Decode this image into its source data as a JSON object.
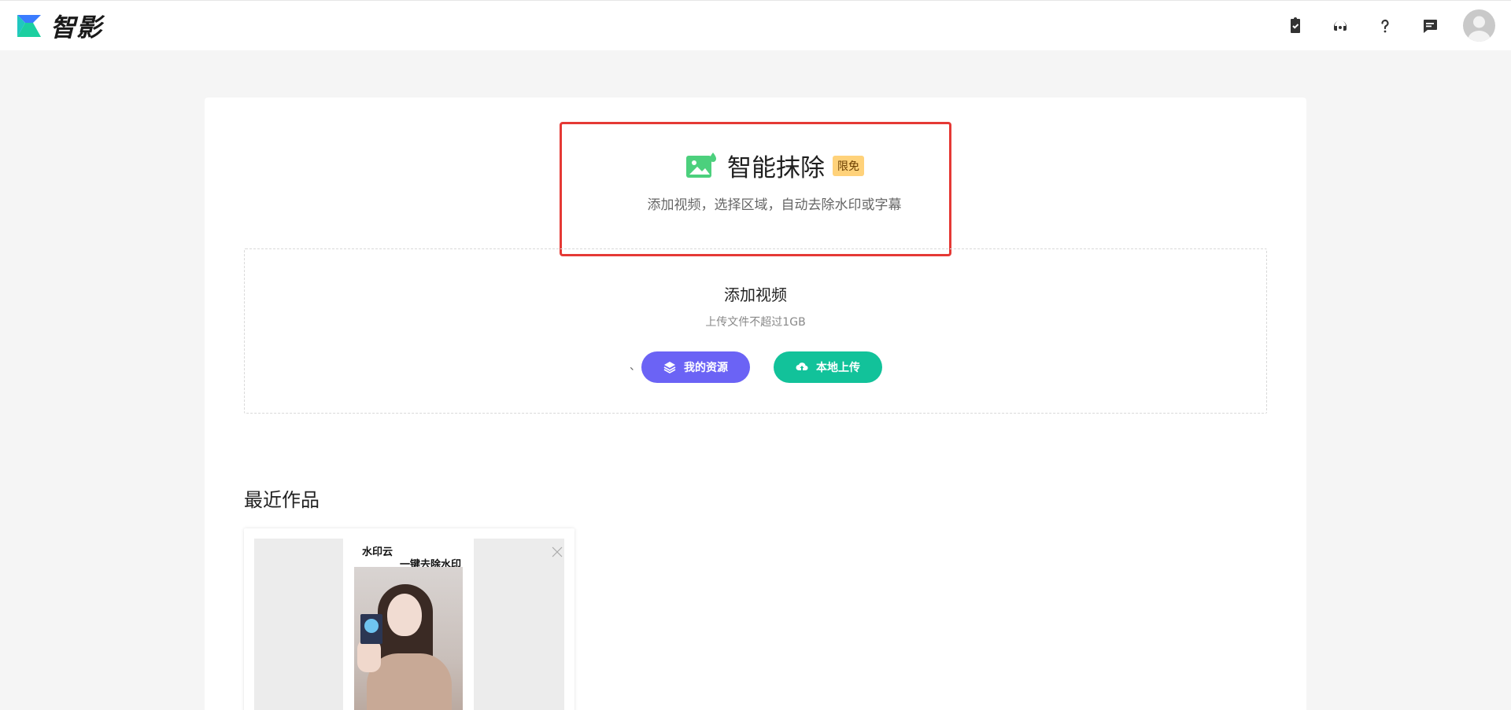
{
  "header": {
    "brand": "智影",
    "icons": [
      "clipboard-check-icon",
      "headset-icon",
      "help-icon",
      "message-icon"
    ],
    "brand_color": "#1ccfa0"
  },
  "feature": {
    "title": "智能抹除",
    "badge": "限免",
    "subtitle": "添加视频，选择区域，自动去除水印或字幕",
    "icon": "image-erase-icon"
  },
  "upload": {
    "title": "添加视频",
    "subtitle": "上传文件不超过1GB",
    "separator": "、",
    "my_resources_label": "我的资源",
    "local_upload_label": "本地上传",
    "resources_color": "#6b63f5",
    "upload_color": "#12c29a"
  },
  "recent": {
    "title": "最近作品",
    "items": [
      {
        "thumb_text_line1": "水印云",
        "thumb_text_line2": "一键去除水印"
      }
    ]
  }
}
